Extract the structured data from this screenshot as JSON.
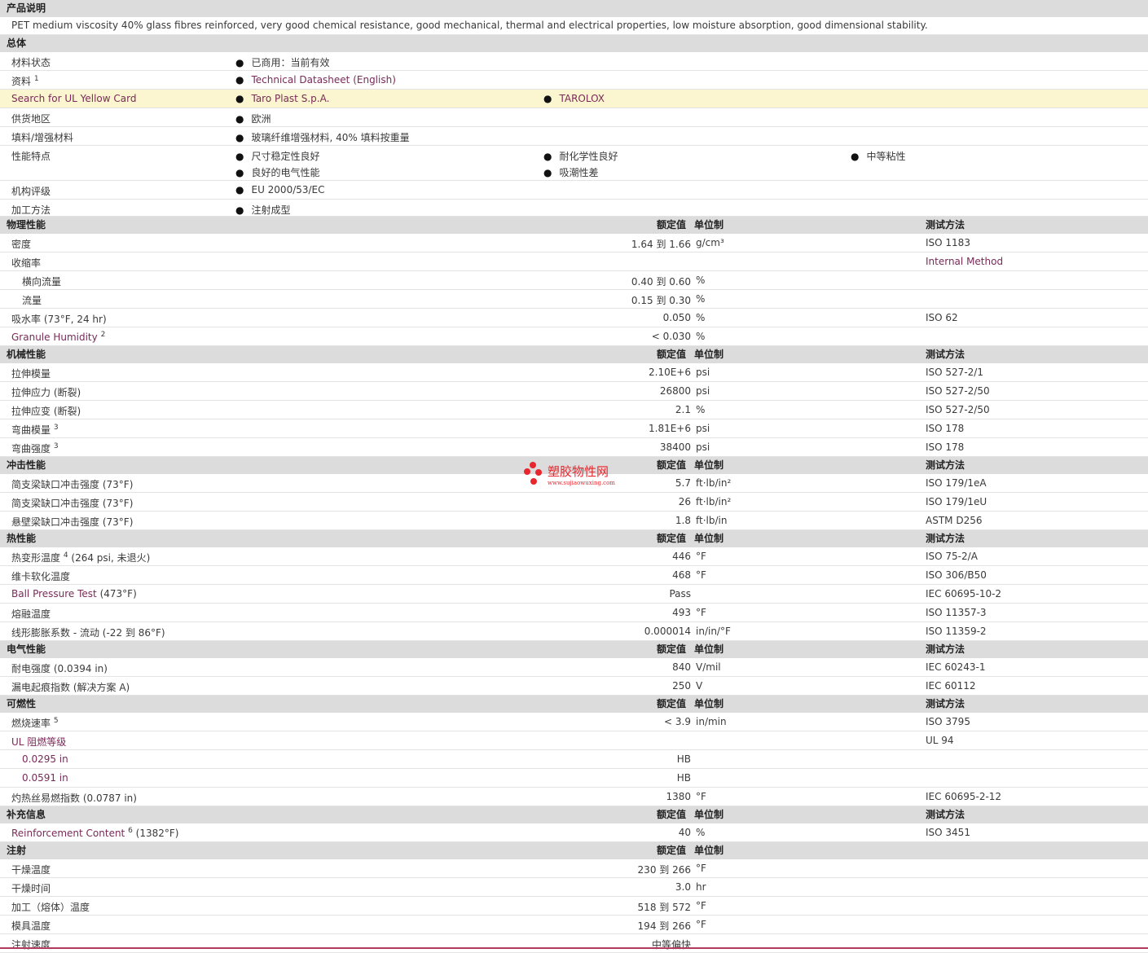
{
  "description": {
    "heading": "产品说明",
    "text": "PET medium viscosity 40% glass fibres reinforced, very good chemical resistance, good mechanical, thermal and electrical properties, low moisture absorption, good dimensional stability."
  },
  "general": {
    "heading": "总体",
    "rows": [
      {
        "label": "材料状态",
        "values": [
          "已商用：当前有效"
        ]
      },
      {
        "label": "资料",
        "sup": "1",
        "values": [
          "Technical Datasheet (English)"
        ]
      },
      {
        "label": "Search for UL Yellow Card",
        "values": [
          "Taro Plast S.p.A.",
          "TAROLOX"
        ]
      },
      {
        "label": "供货地区",
        "values": [
          "欧洲"
        ]
      },
      {
        "label": "填料/增强材料",
        "values": [
          "玻璃纤维增强材料, 40% 填料按重量"
        ]
      },
      {
        "label": "性能特点",
        "values": [
          "尺寸稳定性良好",
          "耐化学性良好",
          "中等粘性",
          "良好的电气性能",
          "吸潮性差"
        ]
      },
      {
        "label": "机构评级",
        "values": [
          "EU 2000/53/EC"
        ]
      },
      {
        "label": "加工方法",
        "values": [
          "注射成型"
        ]
      }
    ]
  },
  "columns": {
    "nominal": "额定值",
    "unit": "单位制",
    "method": "测试方法"
  },
  "sections": [
    {
      "title": "物理性能",
      "rows": [
        {
          "label": "密度",
          "nominal": "1.64 到  1.66",
          "unit": "g/cm³",
          "method": "ISO 1183"
        },
        {
          "label": "收缩率",
          "nominal": "",
          "unit": "",
          "method": "Internal Method"
        },
        {
          "label": "横向流量",
          "nominal": "0.40 到  0.60",
          "unit": "%",
          "method": ""
        },
        {
          "label": "流量",
          "nominal": "0.15 到  0.30",
          "unit": "%",
          "method": ""
        },
        {
          "label": "吸水率",
          "cond": "(73°F, 24 hr)",
          "nominal": "0.050",
          "unit": "%",
          "method": "ISO 62"
        },
        {
          "label": "Granule Humidity",
          "sup": "2",
          "nominal": "< 0.030",
          "unit": "%",
          "method": ""
        }
      ]
    },
    {
      "title": "机械性能",
      "rows": [
        {
          "label": "拉伸模量",
          "nominal": "2.10E+6",
          "unit": "psi",
          "method": "ISO 527-2/1"
        },
        {
          "label": "拉伸应力",
          "cond": "(断裂)",
          "nominal": "26800",
          "unit": "psi",
          "method": "ISO 527-2/50"
        },
        {
          "label": "拉伸应变",
          "cond": "(断裂)",
          "nominal": "2.1",
          "unit": "%",
          "method": "ISO 527-2/50"
        },
        {
          "label": "弯曲模量",
          "sup": "3",
          "nominal": "1.81E+6",
          "unit": "psi",
          "method": "ISO 178"
        },
        {
          "label": "弯曲强度",
          "sup": "3",
          "nominal": "38400",
          "unit": "psi",
          "method": "ISO 178"
        }
      ]
    },
    {
      "title": "冲击性能",
      "rows": [
        {
          "label": "简支梁缺口冲击强度",
          "cond": "(73°F)",
          "nominal": "5.7",
          "unit": "ft·lb/in²",
          "method": "ISO 179/1eA"
        },
        {
          "label": "简支梁缺口冲击强度",
          "cond": "(73°F)",
          "nominal": "26",
          "unit": "ft·lb/in²",
          "method": "ISO 179/1eU"
        },
        {
          "label": "悬壁梁缺口冲击强度",
          "cond": "(73°F)",
          "nominal": "1.8",
          "unit": "ft·lb/in",
          "method": "ASTM D256"
        }
      ]
    },
    {
      "title": "热性能",
      "rows": [
        {
          "label": "热变形温度",
          "sup": "4",
          "cond": "(264 psi, 未退火)",
          "nominal": "446",
          "unit": "°F",
          "method": "ISO 75-2/A"
        },
        {
          "label": "维卡软化温度",
          "nominal": "468",
          "unit": "°F",
          "method": "ISO 306/B50"
        },
        {
          "label": "Ball Pressure Test",
          "cond": "(473°F)",
          "nominal": "Pass",
          "unit": "",
          "method": "IEC 60695-10-2"
        },
        {
          "label": "熔融温度",
          "nominal": "493",
          "unit": "°F",
          "method": "ISO 11357-3"
        },
        {
          "label": "线形膨胀系数 - 流动",
          "cond": "(-22 到  86°F)",
          "nominal": "0.000014",
          "unit": "in/in/°F",
          "method": "ISO 11359-2"
        }
      ]
    },
    {
      "title": "电气性能",
      "rows": [
        {
          "label": "耐电强度",
          "cond": "(0.0394 in)",
          "nominal": "840",
          "unit": "V/mil",
          "method": "IEC 60243-1"
        },
        {
          "label": "漏电起痕指数",
          "cond": "(解决方案  A)",
          "nominal": "250",
          "unit": "V",
          "method": "IEC 60112"
        }
      ]
    },
    {
      "title": "可燃性",
      "rows": [
        {
          "label": "燃烧速率",
          "sup": "5",
          "nominal": "< 3.9",
          "unit": "in/min",
          "method": "ISO 3795"
        },
        {
          "label": "UL 阻燃等级",
          "nominal": "",
          "unit": "",
          "method": "UL 94"
        },
        {
          "label": "0.0295 in",
          "nominal": "HB",
          "unit": "",
          "method": ""
        },
        {
          "label": "0.0591 in",
          "nominal": "HB",
          "unit": "",
          "method": ""
        },
        {
          "label": "灼热丝易燃指数",
          "cond": "(0.0787 in)",
          "nominal": "1380",
          "unit": "°F",
          "method": "IEC 60695-2-12"
        }
      ]
    },
    {
      "title": "补充信息",
      "rows": [
        {
          "label": "Reinforcement Content",
          "sup": "6",
          "cond": "(1382°F)",
          "nominal": "40",
          "unit": "%",
          "method": "ISO 3451"
        }
      ]
    },
    {
      "title": "注射",
      "rows": [
        {
          "label": "干燥温度",
          "nominal": "230 到  266",
          "unit": "°F",
          "method": ""
        },
        {
          "label": "干燥时间",
          "nominal": "3.0",
          "unit": "hr",
          "method": ""
        },
        {
          "label": "加工（熔体）温度",
          "nominal": "518 到  572",
          "unit": "°F",
          "method": ""
        },
        {
          "label": "模具温度",
          "nominal": "194 到  266",
          "unit": "°F",
          "method": ""
        },
        {
          "label": "注射速度",
          "nominal": "中等偏快",
          "unit": "",
          "method": ""
        }
      ]
    }
  ],
  "watermark": {
    "text": "塑胶物性网",
    "url": "www.sujiaowuxing.com"
  },
  "colors": {
    "section_bg": "#dcdcdc",
    "highlight_bg": "#fbf6cf",
    "link": "#7a2a58",
    "watermark": "#e8262d"
  }
}
